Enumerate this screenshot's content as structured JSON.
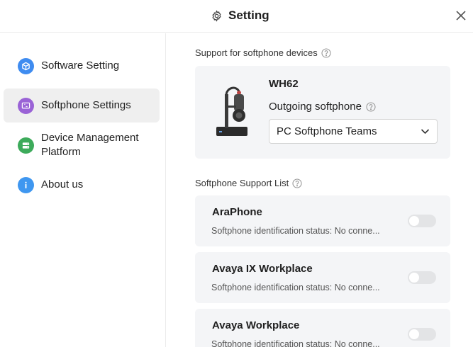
{
  "window": {
    "title": "Setting",
    "title_icon": "gear-icon",
    "close_icon": "close-icon"
  },
  "sidebar": {
    "items": [
      {
        "label": "Software Setting",
        "icon": "cube-icon",
        "color": "#3f8cf0",
        "active": false
      },
      {
        "label": "Softphone Settings",
        "icon": "softphone-icon",
        "color": "#9a63d6",
        "active": true
      },
      {
        "label": "Device Management Platform",
        "icon": "server-icon",
        "color": "#3dab5b",
        "active": false
      },
      {
        "label": "About us",
        "icon": "info-icon",
        "color": "#3f97f0",
        "active": false
      }
    ]
  },
  "main": {
    "support_devices_title": "Support for softphone devices",
    "device": {
      "name": "WH62",
      "image_icon": "headset-base-icon",
      "outgoing_label": "Outgoing softphone",
      "outgoing_value": "PC Softphone Teams"
    },
    "support_list_title": "Softphone Support List",
    "softphones": [
      {
        "name": "AraPhone",
        "status": "Softphone identification status: No conne...",
        "enabled": false
      },
      {
        "name": "Avaya IX Workplace",
        "status": "Softphone identification status: No conne...",
        "enabled": false
      },
      {
        "name": "Avaya Workplace",
        "status": "Softphone identification status: No conne...",
        "enabled": false
      }
    ]
  },
  "colors": {
    "card_bg": "#f4f5f7",
    "active_nav_bg": "#efefef",
    "toggle_off": "#e3e4e6"
  }
}
